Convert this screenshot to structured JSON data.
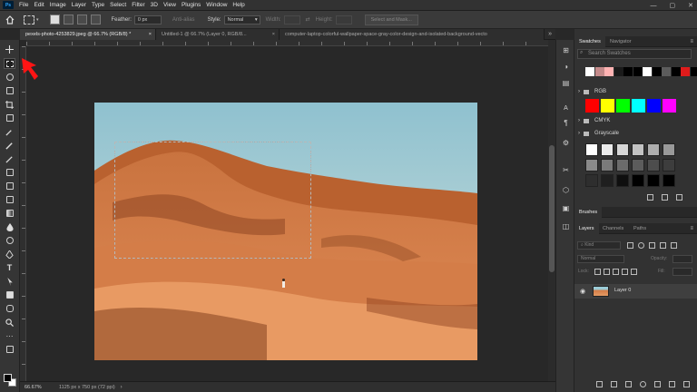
{
  "app": {
    "logo": "Ps",
    "menu": [
      "File",
      "Edit",
      "Image",
      "Layer",
      "Type",
      "Select",
      "Filter",
      "3D",
      "View",
      "Plugins",
      "Window",
      "Help"
    ],
    "window_controls": [
      "—",
      "▢",
      "✕"
    ]
  },
  "options": {
    "feather_label": "Feather:",
    "feather_value": "0 px",
    "anti_alias": "Anti-alias",
    "style_label": "Style:",
    "style_value": "Normal",
    "width_label": "Width:",
    "height_label": "Height:",
    "select_mask": "Select and Mask..."
  },
  "tabs": [
    {
      "label": "pexels-photo-4253829.jpeg @ 66.7% (RGB/8) *",
      "close": "×"
    },
    {
      "label": "Untitled-1 @ 66.7% (Layer 0, RGB/8...",
      "close": "×"
    },
    {
      "label": "computer-laptop-colorful-wallpaper-space-gray-color-design-and-isolated-background-vecto",
      "close": ""
    }
  ],
  "tabs_overflow": "»",
  "status": {
    "zoom": "66.67%",
    "doc_info": "1125 px x 750 px (72 ppi)"
  },
  "panels": {
    "swatches_tab": "Swatches",
    "navigator_tab": "Navigator",
    "search_placeholder": "Search Swatches",
    "recent_colors": [
      "#ffffff",
      "#c48a8a",
      "#ffb3b3",
      "#1a1a1a",
      "#000000",
      "#000000",
      "#ffffff",
      "#000000",
      "#5c5c5c",
      "#000000",
      "#e01b1b",
      "#000000"
    ],
    "folders": {
      "rgb": "RGB",
      "cmyk": "CMYK",
      "grayscale": "Grayscale"
    },
    "rgb_colors": [
      "#ff0000",
      "#ffff00",
      "#00ff00",
      "#00ffff",
      "#0000ff",
      "#ff00ff"
    ],
    "gray_colors": [
      "#ffffff",
      "#ebebeb",
      "#d6d6d6",
      "#c2c2c2",
      "#adadad",
      "#999999",
      "#8a8a8a",
      "#7a7a7a",
      "#6b6b6b",
      "#5c5c5c",
      "#4d4d4d",
      "#3d3d3d",
      "#2e2e2e",
      "#1f1f1f",
      "#0f0f0f",
      "#000000",
      "#000000",
      "#000000"
    ],
    "brushes_tab": "Brushes",
    "layers_tab": "Layers",
    "channels_tab": "Channels",
    "paths_tab": "Paths",
    "kind_label": "Kind",
    "blend_mode": "Normal",
    "opacity_label": "Opacity:",
    "lock_label": "Lock:",
    "fill_label": "Fill:",
    "layer_name": "Layer 0"
  }
}
